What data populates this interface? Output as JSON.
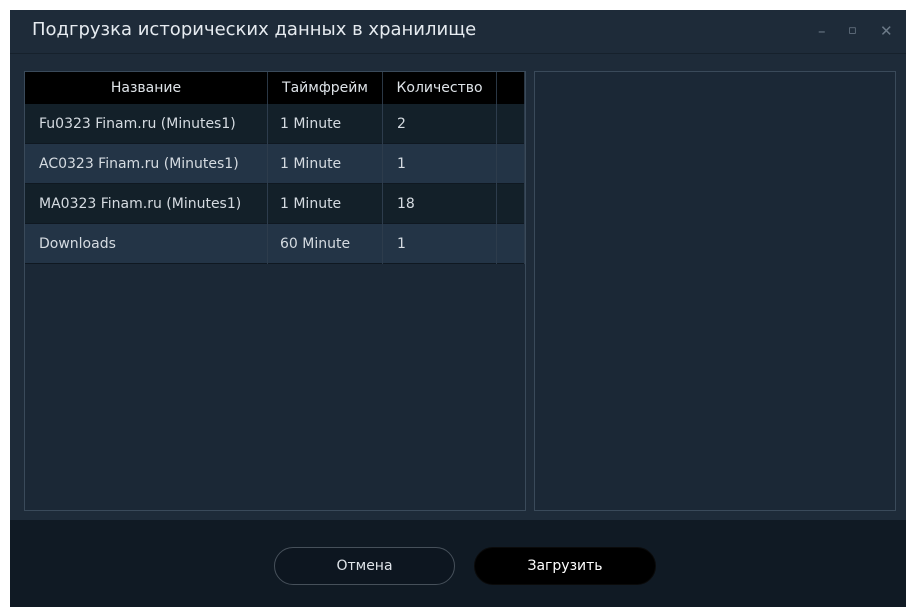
{
  "window": {
    "title": "Подгрузка исторических данных в хранилище",
    "controls": {
      "minimize": "–",
      "maximize": "▫",
      "close": "✕"
    }
  },
  "table": {
    "columns": [
      "Название",
      "Таймфрейм",
      "Количество"
    ],
    "rows": [
      {
        "name": "Fu0323 Finam.ru (Minutes1)",
        "timeframe": "1 Minute",
        "count": "2"
      },
      {
        "name": "AC0323 Finam.ru (Minutes1)",
        "timeframe": "1 Minute",
        "count": "1"
      },
      {
        "name": "MA0323 Finam.ru (Minutes1)",
        "timeframe": "1 Minute",
        "count": "18"
      },
      {
        "name": "Downloads",
        "timeframe": "60 Minute",
        "count": "1"
      }
    ]
  },
  "footer": {
    "cancel_label": "Отмена",
    "load_label": "Загрузить"
  },
  "colors": {
    "window_bg": "#1e2b39",
    "header_bg": "#000000",
    "row_dark": "#132029",
    "row_light": "#233446",
    "footer_bg": "#101a24"
  }
}
